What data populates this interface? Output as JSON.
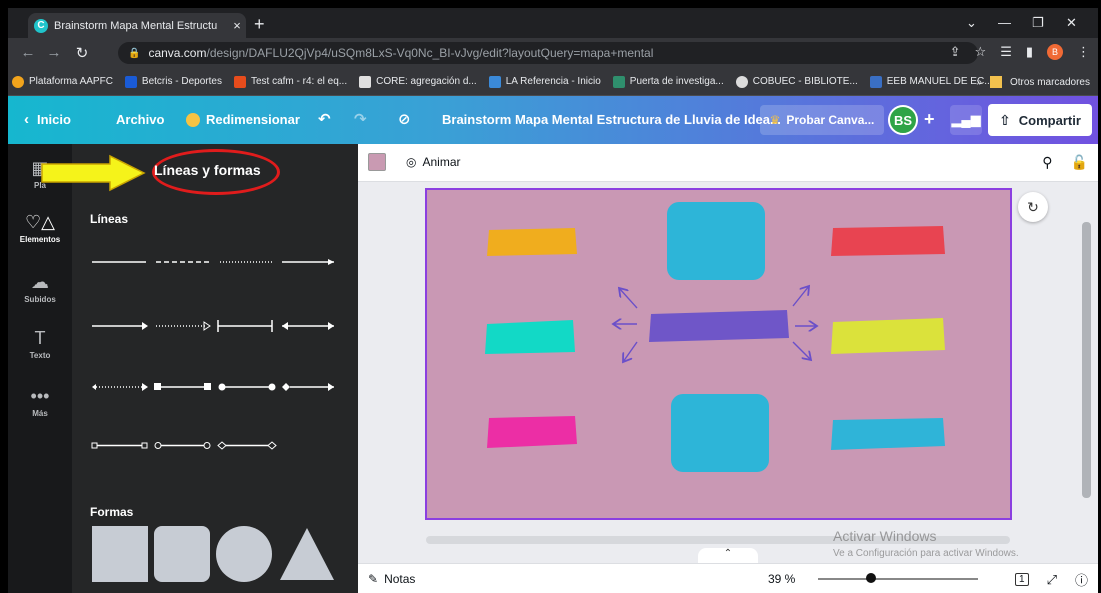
{
  "browser": {
    "tab_title": "Brainstorm Mapa Mental Estructu",
    "url_host": "canva.com",
    "url_path": "/design/DAFLU2QjVp4/uSQm8LxS-Vq0Nc_BI-vJvg/edit?layoutQuery=mapa+mental",
    "profile_initial": "B",
    "bookmarks": [
      "Plataforma AAPFC",
      "Betcris - Deportes",
      "Test cafm - r4: el eq...",
      "CORE: agregación d...",
      "LA Referencia - Inicio",
      "Puerta de investiga...",
      "COBUEC - BIBLIOTE...",
      "EEB MANUEL DE EC..."
    ],
    "bookmarks_more": "»",
    "other_bookmarks": "Otros marcadores"
  },
  "header": {
    "home": "Inicio",
    "file": "Archivo",
    "resize": "Redimensionar",
    "doc_title": "Brainstorm Mapa Mental Estructura de Lluvia de Idea...",
    "try_canva": "Probar Canva...",
    "avatar": "BS",
    "share": "Compartir"
  },
  "rail": {
    "items": [
      "Pla",
      "Elementos",
      "Subidos",
      "Texto",
      "Más"
    ]
  },
  "panel": {
    "title": "Líneas y formas",
    "lines_heading": "Líneas",
    "shapes_heading": "Formas"
  },
  "editor": {
    "animate": "Animar",
    "notes": "Notas",
    "zoom": "39 %",
    "zoom_fraction": 0.3,
    "page_count": "1",
    "canvas_bg": "#c998b4",
    "watermark_title": "Activar Windows",
    "watermark_sub": "Ve a Configuración para activar Windows."
  },
  "colors": {
    "yellow_stroke": "#f0ad1e",
    "cyan_stroke": "#12d9c6",
    "pink_stroke": "#ec2ea5",
    "red_stroke": "#e84451",
    "lime_stroke": "#dbe23b",
    "blue_stroke": "#2fb4d8",
    "center_stroke": "#6f56c8",
    "box": "#2db5d8",
    "arrow": "#6a4fc9"
  }
}
